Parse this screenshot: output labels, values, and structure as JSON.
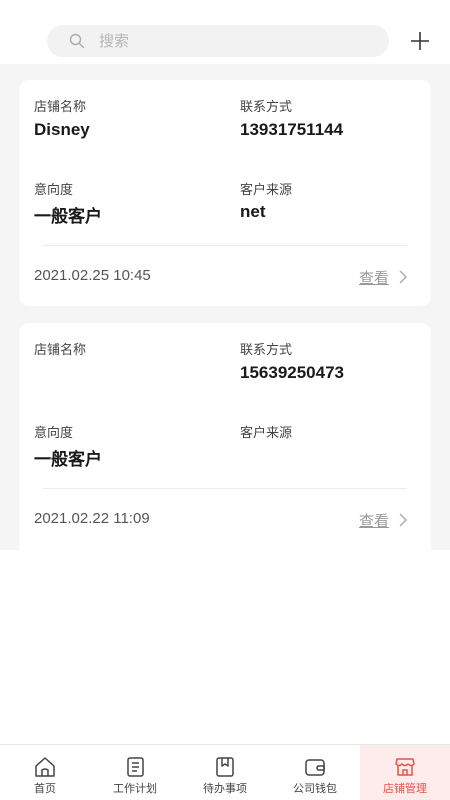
{
  "search": {
    "placeholder": "搜索",
    "icon": "search-icon"
  },
  "toolbar": {
    "add_icon": "plus-icon"
  },
  "labels": {
    "store_name": "店铺名称",
    "contact": "联系方式",
    "intent": "意向度",
    "source": "客户来源",
    "view": "查看"
  },
  "customers": [
    {
      "store_name": "Disney",
      "contact": "13931751144",
      "intent": "一般客户",
      "source": "net",
      "time": "2021.02.25 10:45"
    },
    {
      "store_name": "",
      "contact": "15639250473",
      "intent": "一般客户",
      "source": "",
      "time": "2021.02.22 11:09"
    }
  ],
  "tabs": [
    {
      "label": "首页",
      "icon": "home-icon",
      "active": false
    },
    {
      "label": "工作计划",
      "icon": "work-plan-icon",
      "active": false
    },
    {
      "label": "待办事项",
      "icon": "todo-icon",
      "active": false
    },
    {
      "label": "公司钱包",
      "icon": "wallet-icon",
      "active": false
    },
    {
      "label": "店铺管理",
      "icon": "store-icon",
      "active": true
    }
  ],
  "colors": {
    "accent": "#e2554b",
    "active_tab_bg": "#fdeceb",
    "list_bg": "#f5f5f5"
  }
}
